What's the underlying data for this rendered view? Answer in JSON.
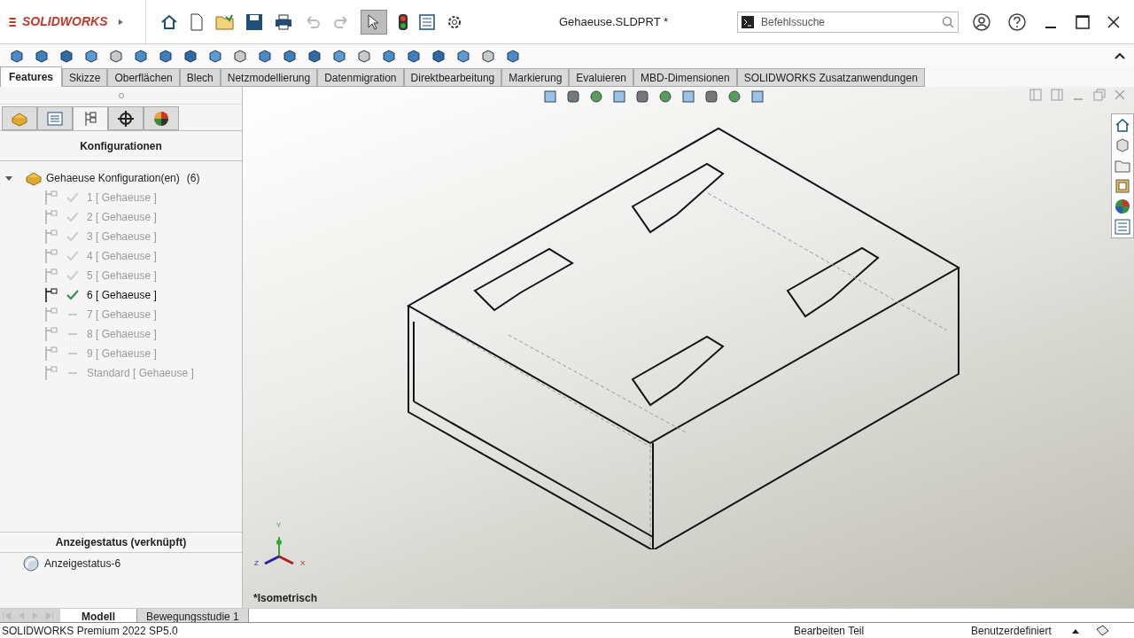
{
  "app": {
    "logo": "SOLIDWORKS",
    "title": "Gehaeuse.SLDPRT *"
  },
  "search": {
    "placeholder": "Befehlssuche"
  },
  "tabs": [
    {
      "label": "Features",
      "selected": true
    },
    {
      "label": "Skizze",
      "selected": false
    },
    {
      "label": "Oberflächen",
      "selected": false
    },
    {
      "label": "Blech",
      "selected": false
    },
    {
      "label": "Netzmodellierung",
      "selected": false
    },
    {
      "label": "Datenmigration",
      "selected": false
    },
    {
      "label": "Direktbearbeitung",
      "selected": false
    },
    {
      "label": "Markierung",
      "selected": false
    },
    {
      "label": "Evaluieren",
      "selected": false
    },
    {
      "label": "MBD-Dimensionen",
      "selected": false
    },
    {
      "label": "SOLIDWORKS Zusatzanwendungen",
      "selected": false
    }
  ],
  "panel": {
    "title": "Konfigurationen",
    "tree_root": "Gehaeuse Konfiguration(en)",
    "root_count": "(6)",
    "configurations": [
      {
        "label": "1 [ Gehaeuse ]",
        "kind": "check",
        "selected": false
      },
      {
        "label": "2 [ Gehaeuse ]",
        "kind": "check",
        "selected": false
      },
      {
        "label": "3 [ Gehaeuse ]",
        "kind": "check",
        "selected": false
      },
      {
        "label": "4 [ Gehaeuse ]",
        "kind": "check",
        "selected": false
      },
      {
        "label": "5 [ Gehaeuse ]",
        "kind": "check",
        "selected": false
      },
      {
        "label": "6 [ Gehaeuse ]",
        "kind": "check",
        "selected": true
      },
      {
        "label": "7 [ Gehaeuse ]",
        "kind": "dash",
        "selected": false
      },
      {
        "label": "8 [ Gehaeuse ]",
        "kind": "dash",
        "selected": false
      },
      {
        "label": "9 [ Gehaeuse ]",
        "kind": "dash",
        "selected": false
      },
      {
        "label": "Standard [ Gehaeuse ]",
        "kind": "dash",
        "selected": false
      }
    ],
    "display_state_title": "Anzeigestatus (verknüpft)",
    "display_state": "Anzeigestatus-6"
  },
  "viewport": {
    "view_name": "*Isometrisch",
    "axes": [
      "Y",
      "Z",
      "X"
    ]
  },
  "bottom_tabs": [
    {
      "label": "Modell",
      "selected": true
    },
    {
      "label": "Bewegungsstudie 1",
      "selected": false
    }
  ],
  "status_bar": {
    "version": "SOLIDWORKS Premium 2022 SP5.0",
    "mode": "Bearbeiten Teil",
    "units": "Benutzerdefiniert"
  }
}
